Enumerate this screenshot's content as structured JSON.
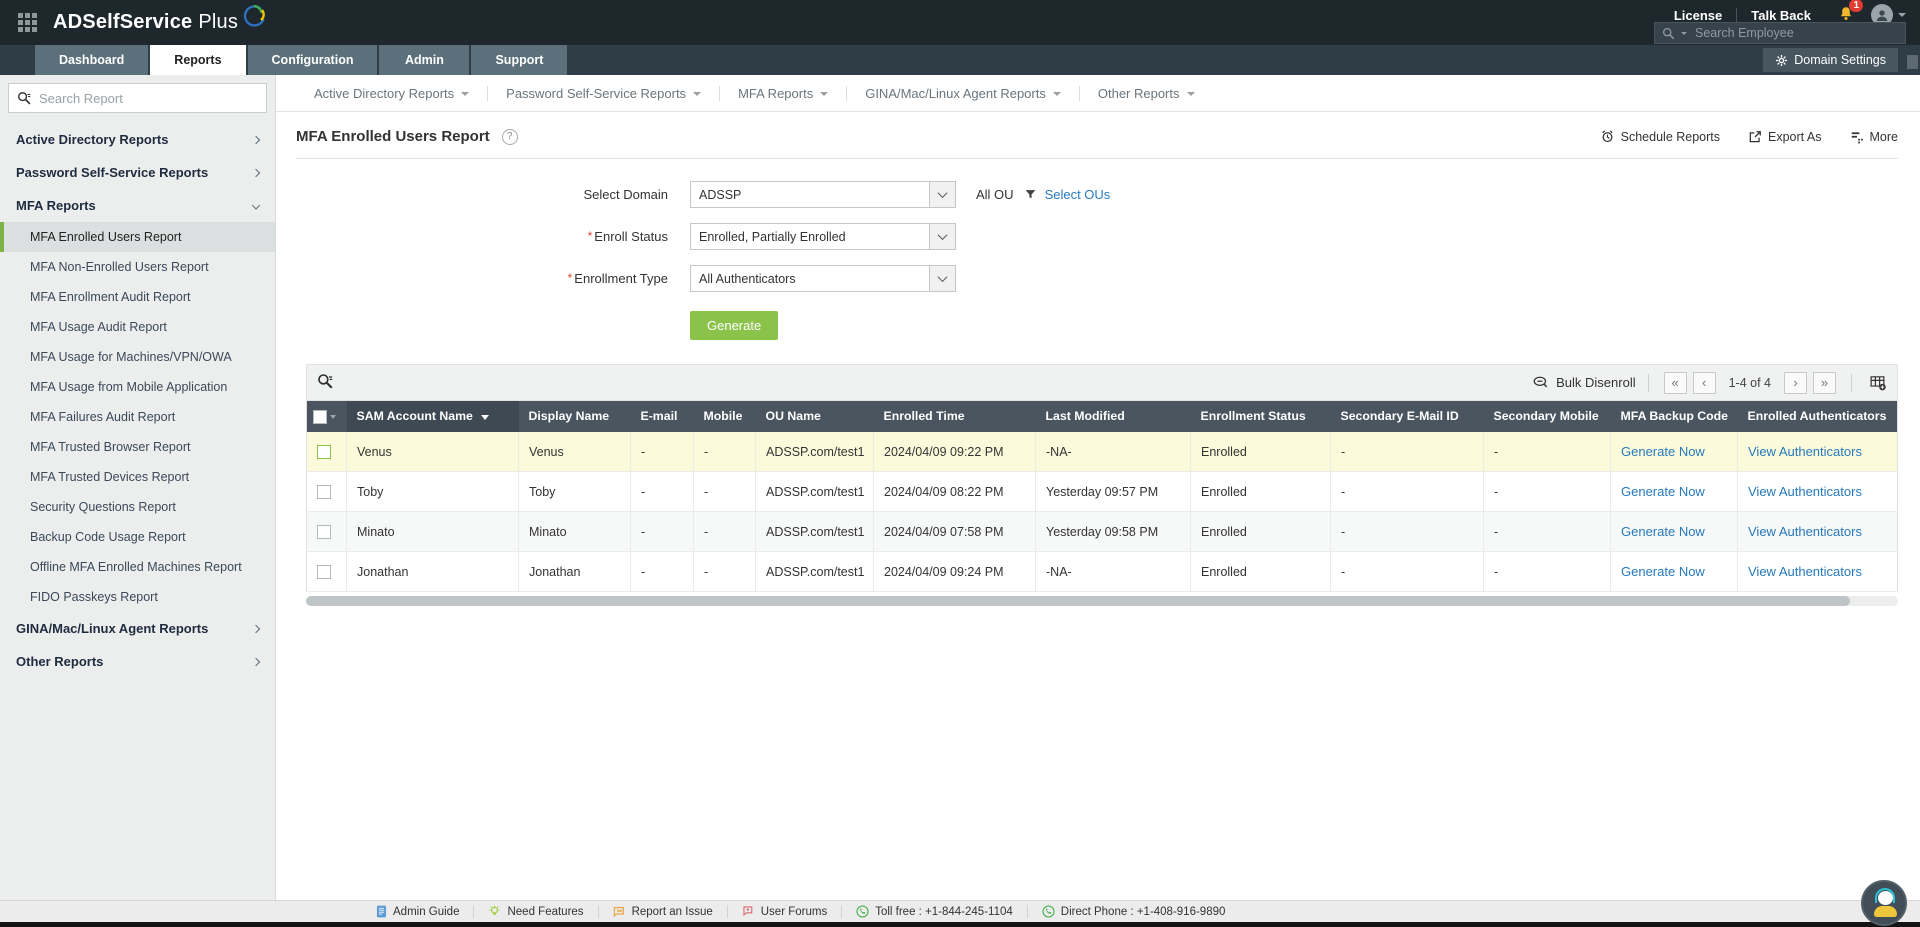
{
  "icons": {
    "help_glyph": "?",
    "first": "«",
    "prev": "‹",
    "next": "›",
    "last": "»"
  },
  "colors": {
    "accent_green": "#8bc34a",
    "link_blue": "#2779bd",
    "header_dark": "#1e272c",
    "table_header": "#4a5560",
    "row_highlight": "#fbfbdc"
  },
  "header": {
    "product": "ADSelfService",
    "product_suffix": "Plus",
    "license": "License",
    "talk_back": "Talk Back",
    "badge_count": "1",
    "search_placeholder": "Search Employee",
    "domain_settings": "Domain Settings"
  },
  "nav": {
    "tabs": [
      {
        "label": "Dashboard",
        "active": false
      },
      {
        "label": "Reports",
        "active": true
      },
      {
        "label": "Configuration",
        "active": false
      },
      {
        "label": "Admin",
        "active": false
      },
      {
        "label": "Support",
        "active": false
      }
    ]
  },
  "sidebar": {
    "search_placeholder": "Search Report",
    "items": [
      {
        "label": "Active Directory Reports",
        "type": "group"
      },
      {
        "label": "Password Self-Service Reports",
        "type": "group"
      },
      {
        "label": "MFA Reports",
        "type": "group-expanded"
      },
      {
        "label": "MFA Enrolled Users Report",
        "type": "sub",
        "selected": true
      },
      {
        "label": "MFA Non-Enrolled Users Report",
        "type": "sub"
      },
      {
        "label": "MFA Enrollment Audit Report",
        "type": "sub"
      },
      {
        "label": "MFA Usage Audit Report",
        "type": "sub"
      },
      {
        "label": "MFA Usage for Machines/VPN/OWA",
        "type": "sub"
      },
      {
        "label": "MFA Usage from Mobile Application",
        "type": "sub"
      },
      {
        "label": "MFA Failures Audit Report",
        "type": "sub"
      },
      {
        "label": "MFA Trusted Browser Report",
        "type": "sub"
      },
      {
        "label": "MFA Trusted Devices Report",
        "type": "sub"
      },
      {
        "label": "Security Questions Report",
        "type": "sub"
      },
      {
        "label": "Backup Code Usage Report",
        "type": "sub"
      },
      {
        "label": "Offline MFA Enrolled Machines Report",
        "type": "sub"
      },
      {
        "label": "FIDO Passkeys Report",
        "type": "sub"
      },
      {
        "label": "GINA/Mac/Linux Agent Reports",
        "type": "group"
      },
      {
        "label": "Other Reports",
        "type": "group"
      }
    ]
  },
  "secondary_nav": {
    "items": [
      "Active Directory Reports",
      "Password Self-Service Reports",
      "MFA Reports",
      "GINA/Mac/Linux Agent Reports",
      "Other Reports"
    ]
  },
  "report": {
    "title": "MFA Enrolled Users Report",
    "actions": {
      "schedule": "Schedule Reports",
      "export": "Export As",
      "more": "More"
    },
    "form": {
      "select_domain_label": "Select Domain",
      "select_domain_value": "ADSSP",
      "all_ou_label": "All OU",
      "select_ous_label": "Select OUs",
      "enroll_status_label": "Enroll Status",
      "enroll_status_value": "Enrolled, Partially Enrolled",
      "enrollment_type_label": "Enrollment Type",
      "enrollment_type_value": "All Authenticators",
      "generate_label": "Generate"
    },
    "table": {
      "bulk_disenroll": "Bulk Disenroll",
      "page_info": "1-4 of 4",
      "columns": [
        "SAM Account Name",
        "Display Name",
        "E-mail",
        "Mobile",
        "OU Name",
        "Enrolled Time",
        "Last Modified",
        "Enrollment Status",
        "Secondary E-Mail ID",
        "Secondary Mobile",
        "MFA Backup Code",
        "Enrolled Authenticators"
      ],
      "rows": [
        {
          "sam": "Venus",
          "display": "Venus",
          "email": "-",
          "mobile": "-",
          "ou": "ADSSP.com/test1",
          "enrolled": "2024/04/09 09:22 PM",
          "modified": "-NA-",
          "status": "Enrolled",
          "sec_email": "-",
          "sec_mobile": "-",
          "backup": "Generate Now",
          "auth": "View Authenticators"
        },
        {
          "sam": "Toby",
          "display": "Toby",
          "email": "-",
          "mobile": "-",
          "ou": "ADSSP.com/test1",
          "enrolled": "2024/04/09 08:22 PM",
          "modified": "Yesterday 09:57 PM",
          "status": "Enrolled",
          "sec_email": "-",
          "sec_mobile": "-",
          "backup": "Generate Now",
          "auth": "View Authenticators"
        },
        {
          "sam": "Minato",
          "display": "Minato",
          "email": "-",
          "mobile": "-",
          "ou": "ADSSP.com/test1",
          "enrolled": "2024/04/09 07:58 PM",
          "modified": "Yesterday 09:58 PM",
          "status": "Enrolled",
          "sec_email": "-",
          "sec_mobile": "-",
          "backup": "Generate Now",
          "auth": "View Authenticators"
        },
        {
          "sam": "Jonathan",
          "display": "Jonathan",
          "email": "-",
          "mobile": "-",
          "ou": "ADSSP.com/test1",
          "enrolled": "2024/04/09 09:24 PM",
          "modified": "-NA-",
          "status": "Enrolled",
          "sec_email": "-",
          "sec_mobile": "-",
          "backup": "Generate Now",
          "auth": "View Authenticators"
        }
      ]
    }
  },
  "footer": {
    "items": [
      "Admin Guide",
      "Need Features",
      "Report an Issue",
      "User Forums",
      "Toll free : +1-844-245-1104",
      "Direct Phone : +1-408-916-9890"
    ]
  }
}
